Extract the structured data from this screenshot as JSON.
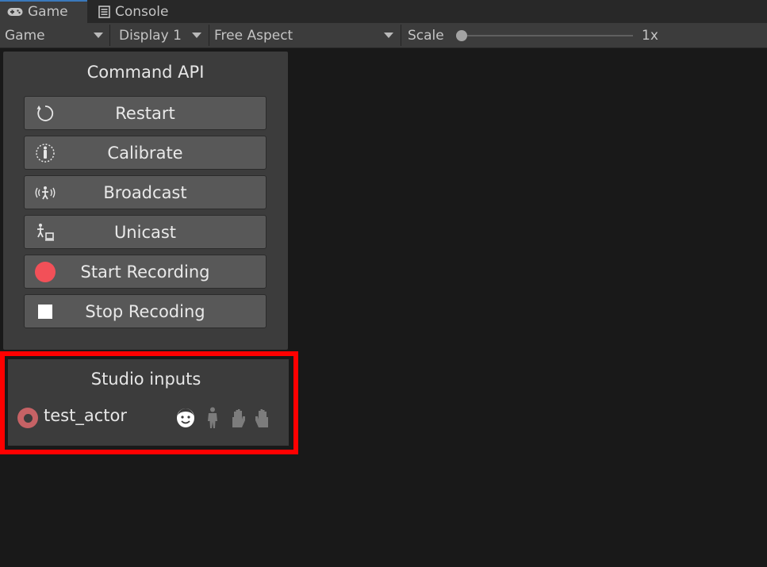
{
  "tabs": [
    {
      "label": "Game",
      "icon": "gamepad-icon",
      "active": true
    },
    {
      "label": "Console",
      "icon": "console-icon",
      "active": false
    }
  ],
  "toolbar": {
    "view_dropdown": "Game",
    "display_dropdown": "Display 1",
    "aspect_dropdown": "Free Aspect",
    "scale_label": "Scale",
    "scale_value": "1x",
    "scale_fraction": 0.0
  },
  "command_panel": {
    "title": "Command API",
    "buttons": [
      {
        "label": "Restart",
        "icon": "restart-icon"
      },
      {
        "label": "Calibrate",
        "icon": "calibrate-icon"
      },
      {
        "label": "Broadcast",
        "icon": "broadcast-icon"
      },
      {
        "label": "Unicast",
        "icon": "unicast-icon"
      },
      {
        "label": "Start Recording",
        "icon": "record-icon"
      },
      {
        "label": "Stop Recoding",
        "icon": "stop-icon"
      }
    ]
  },
  "studio_inputs": {
    "title": "Studio inputs",
    "actor": {
      "name": "test_actor",
      "status_icon": "actor-status-icon",
      "streams": [
        {
          "icon": "face-icon",
          "active": true
        },
        {
          "icon": "body-icon",
          "active": false
        },
        {
          "icon": "left-hand-icon",
          "active": false
        },
        {
          "icon": "right-hand-icon",
          "active": false
        }
      ]
    }
  },
  "colors": {
    "background": "#191919",
    "panel": "#3c3c3c",
    "button": "#585858",
    "record": "#f25058",
    "actor_status": "#c66265",
    "highlight": "#ff0000",
    "tab_accent": "#3a79bb"
  }
}
